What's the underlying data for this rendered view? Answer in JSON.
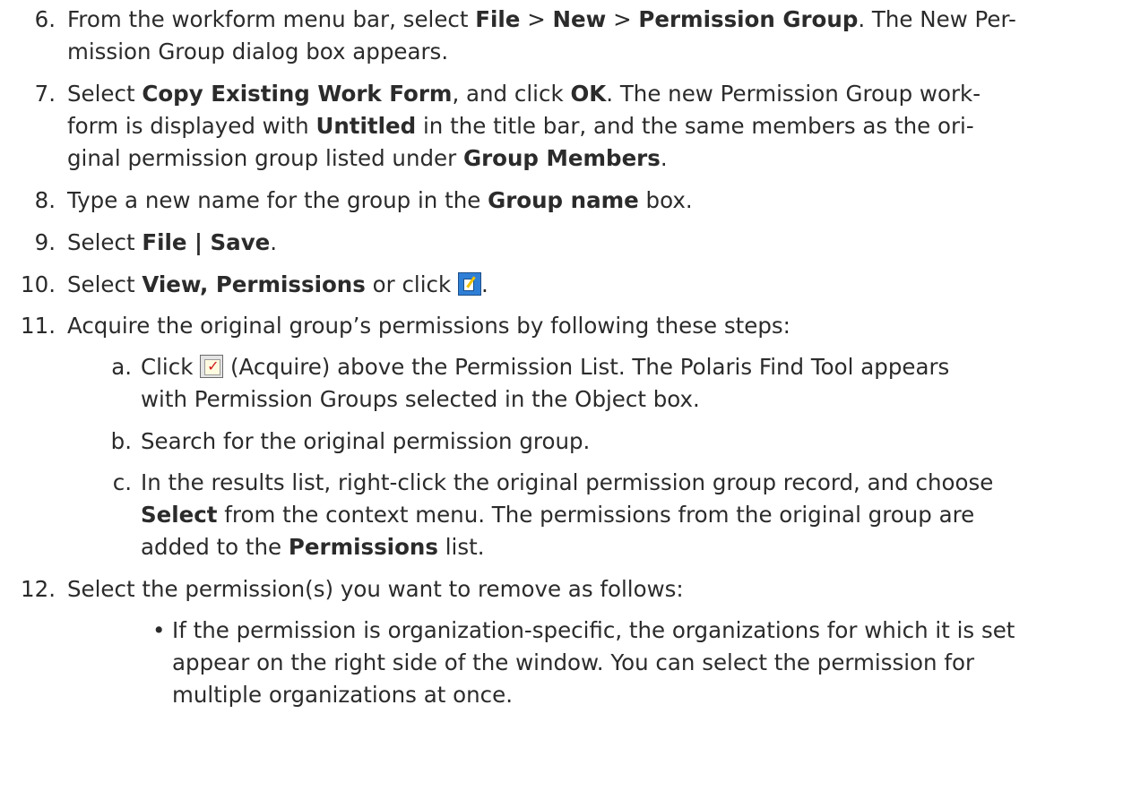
{
  "steps": [
    {
      "num": "6.",
      "lines": [
        [
          "From the workform menu bar, select ",
          {
            "b": "File"
          },
          " > ",
          {
            "b": "New"
          },
          " > ",
          {
            "b": "Permission Group"
          },
          ". The New Per-"
        ],
        [
          "mission Group dialog box appears."
        ]
      ]
    },
    {
      "num": "7.",
      "lines": [
        [
          "Select ",
          {
            "b": "Copy Existing Work Form"
          },
          ", and click ",
          {
            "b": "OK"
          },
          ". The new Permission Group work-"
        ],
        [
          "form is displayed with ",
          {
            "b": "Untitled"
          },
          " in the title bar, and the same members as the ori-"
        ],
        [
          "ginal permission group listed under ",
          {
            "b": "Group Members"
          },
          "."
        ]
      ]
    },
    {
      "num": "8.",
      "lines": [
        [
          "Type a new name for the group in the ",
          {
            "b": "Group name"
          },
          " box."
        ]
      ]
    },
    {
      "num": "9.",
      "lines": [
        [
          "Select ",
          {
            "b": "File | Save"
          },
          "."
        ]
      ]
    },
    {
      "num": "10.",
      "lines": [
        [
          "Select ",
          {
            "b": "View, Permissions"
          },
          " or click ",
          {
            "icon": "permissions-icon"
          },
          "."
        ]
      ]
    },
    {
      "num": "11.",
      "lines": [
        [
          "Acquire the original group’s permissions by following these steps:"
        ]
      ]
    },
    {
      "num": "12.",
      "lines": [
        [
          "Select the permission(s) you want to remove as follows:"
        ]
      ]
    }
  ],
  "substeps": [
    {
      "letter": "a.",
      "lines": [
        [
          "Click ",
          {
            "icon": "acquire-icon"
          },
          " (Acquire) above the Permission List. The Polaris Find Tool appears"
        ],
        [
          "with Permission Groups selected in the Object box."
        ]
      ]
    },
    {
      "letter": "b.",
      "lines": [
        [
          "Search for the original permission group."
        ]
      ]
    },
    {
      "letter": "c.",
      "lines": [
        [
          "In the results list, right-click the original permission group record, and choose"
        ],
        [
          {
            "b": "Select"
          },
          " from the context menu. The permissions from the original group are"
        ],
        [
          "added to the ",
          {
            "b": "Permissions"
          },
          " list."
        ]
      ]
    }
  ],
  "bullets": [
    {
      "lines": [
        [
          "If the permission is organization-specific, the organizations for which it is set"
        ],
        [
          "appear on the right side of the window. You can select the permission for"
        ],
        [
          "multiple organizations at once."
        ]
      ]
    }
  ],
  "bullet_char": "•"
}
